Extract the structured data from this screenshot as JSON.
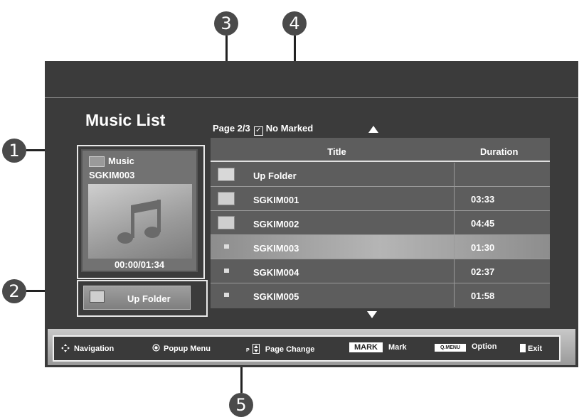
{
  "callouts": [
    "1",
    "2",
    "3",
    "4",
    "5"
  ],
  "screen": {
    "title": "Music List",
    "page_info": "Page 2/3",
    "mark_status": "No Marked",
    "check_glyph": "✓"
  },
  "preview": {
    "folder_name": "Music",
    "song": "SGKIM003",
    "time": "00:00/01:34",
    "note_icon": "music-note-icon"
  },
  "up_folder_button": {
    "label": "Up Folder"
  },
  "table": {
    "headers": {
      "title": "Title",
      "duration": "Duration"
    },
    "rows": [
      {
        "name": "Up Folder",
        "duration": "",
        "icon": "up-folder-icon"
      },
      {
        "name": "SGKIM001",
        "duration": "03:33",
        "icon": "folder-icon"
      },
      {
        "name": "SGKIM002",
        "duration": "04:45",
        "icon": "folder-icon"
      },
      {
        "name": "SGKIM003",
        "duration": "01:30",
        "icon": "file-icon",
        "selected": true
      },
      {
        "name": "SGKIM004",
        "duration": "02:37",
        "icon": "file-icon"
      },
      {
        "name": "SGKIM005",
        "duration": "01:58",
        "icon": "file-icon"
      }
    ]
  },
  "footer": {
    "navigation": "Navigation",
    "popup_menu": "Popup Menu",
    "page_prefix": "P",
    "page_change": "Page Change",
    "mark_key": "MARK",
    "mark": "Mark",
    "qmenu_key": "Q.MENU",
    "option": "Option",
    "exit": "Exit"
  }
}
